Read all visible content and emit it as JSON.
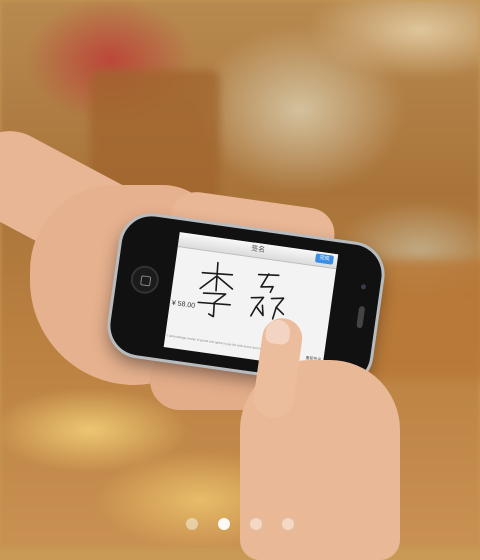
{
  "phone_screen": {
    "nav_title": "签名",
    "done_label": "完成",
    "amount": "¥ 58.00",
    "terms": "I acknowledge receipt of goods and agree to pay the total above according to cardholder agreement",
    "clear_label": "重新签名",
    "signature_text": "李磊"
  },
  "pagination": {
    "total": 4,
    "active_index": 1
  }
}
